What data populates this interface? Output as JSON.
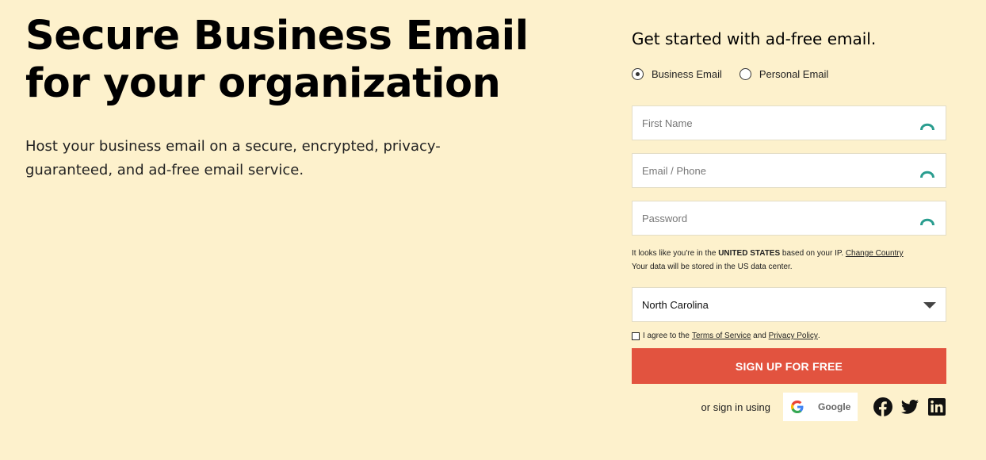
{
  "hero": {
    "title_line1": "Secure Business Email",
    "title_line2": "for your organization",
    "subtitle": "Host your business email on a secure, encrypted, privacy-guaranteed, and ad-free email service."
  },
  "form": {
    "heading": "Get started with ad-free email.",
    "account_types": [
      {
        "label": "Business Email",
        "selected": true
      },
      {
        "label": "Personal Email",
        "selected": false
      }
    ],
    "fields": {
      "first_name": {
        "placeholder": "First Name",
        "value": ""
      },
      "email_phone": {
        "placeholder": "Email / Phone",
        "value": ""
      },
      "password": {
        "placeholder": "Password",
        "value": ""
      }
    },
    "notice": {
      "prefix": "It looks like you're in the ",
      "country": "UNITED STATES",
      "middle": " based on your IP. ",
      "change_link": "Change Country",
      "line2": "Your data will be stored in the US data center."
    },
    "region": {
      "selected": "North Carolina"
    },
    "agree": {
      "prefix": "I agree to the ",
      "terms_link": "Terms of Service",
      "and": " and ",
      "privacy_link": "Privacy Policy",
      "suffix": ".",
      "checked": false
    },
    "submit_label": "SIGN UP FOR FREE",
    "social": {
      "or_text": "or sign in using",
      "google_label": "Google",
      "icons": [
        "facebook-icon",
        "twitter-icon",
        "linkedin-icon"
      ]
    }
  },
  "colors": {
    "background": "#fdf1cc",
    "primary_button": "#e2533f",
    "eye_icon": "#2a9d8f"
  }
}
